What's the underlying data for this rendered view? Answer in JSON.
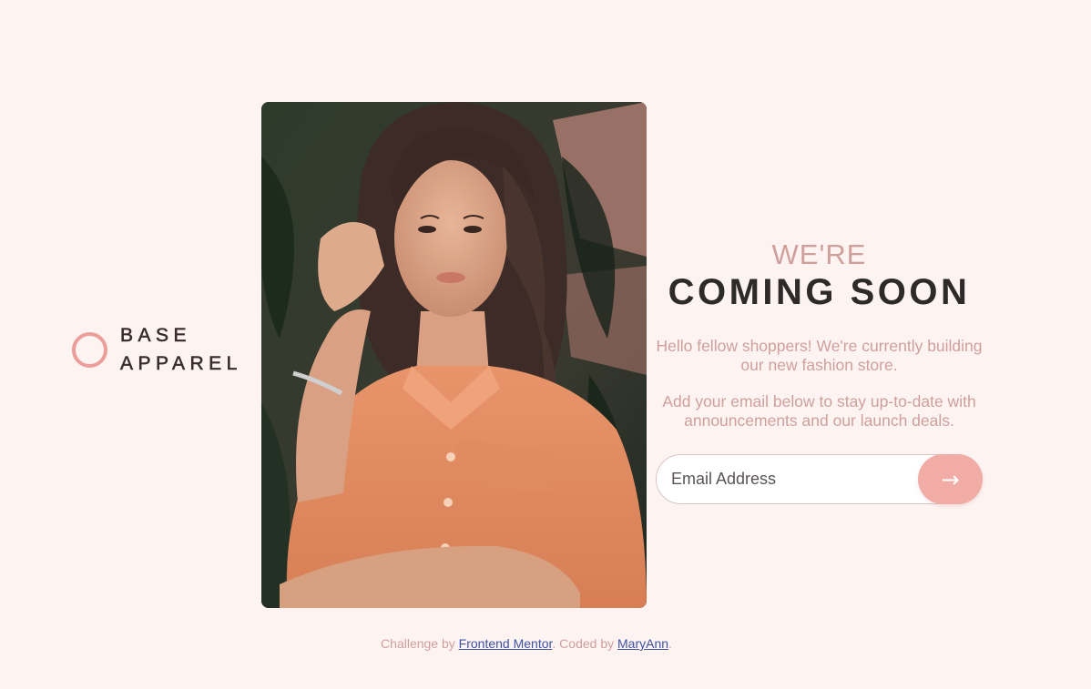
{
  "brand": {
    "line1": "BASE",
    "line2": "APPAREL",
    "accent_color": "#eb9e9a",
    "text_color": "#3a2d2e"
  },
  "hero_image": {
    "alt": "Woman in an orange shirt"
  },
  "headline": {
    "light": "WE'RE",
    "bold": "COMING SOON"
  },
  "paragraphs": {
    "intro": "Hello fellow shoppers! We're currently building our new fashion store.",
    "cta": "Add your email below to stay up-to-date with announcements and our launch deals."
  },
  "form": {
    "placeholder": "Email Address",
    "submit_icon": "arrow-right-icon",
    "submit_glyph": "→"
  },
  "attribution": {
    "prefix": "Challenge by ",
    "link1": "Frontend Mentor",
    "middle": ". Coded by ",
    "link2": "MaryAnn",
    "suffix": "."
  },
  "colors": {
    "background": "#fdf4f2",
    "pink_text": "#cf9f9c",
    "dark_text": "#2f2a2a",
    "button": "#f2aca6",
    "link": "#3e52a3"
  }
}
